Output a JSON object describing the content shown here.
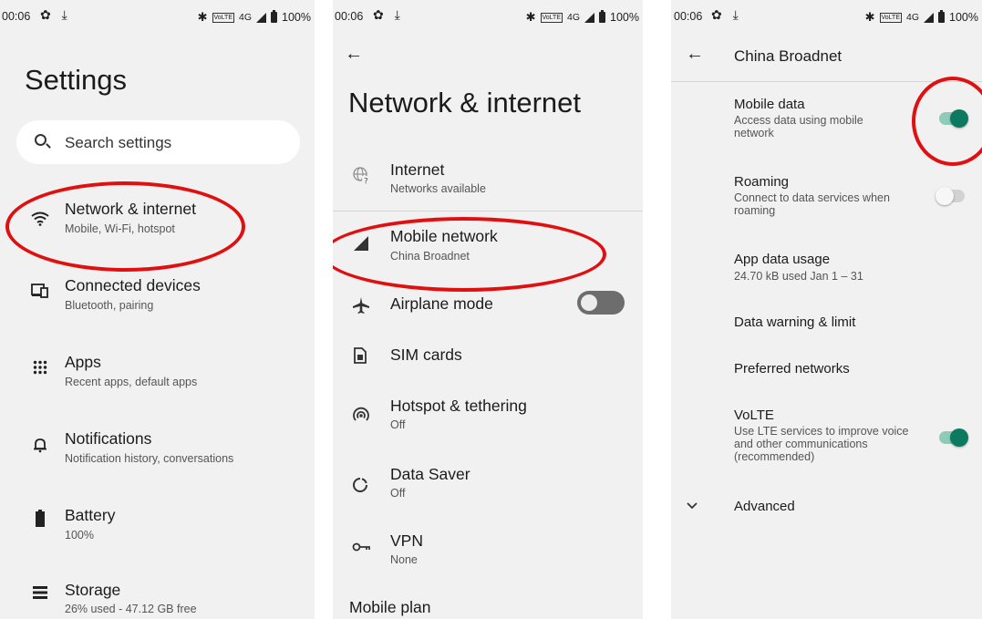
{
  "status_bar": {
    "time": "00:06",
    "left_icons": "✿ ⤓",
    "bluetooth_icon": "bluetooth-icon",
    "volte_badge": "VoLTE",
    "network": "4G",
    "battery": "100%"
  },
  "panel1": {
    "title": "Settings",
    "search_placeholder": "Search settings",
    "items": [
      {
        "title": "Network & internet",
        "subtitle": "Mobile, Wi-Fi, hotspot",
        "icon": "wifi-icon"
      },
      {
        "title": "Connected devices",
        "subtitle": "Bluetooth, pairing",
        "icon": "devices-icon"
      },
      {
        "title": "Apps",
        "subtitle": "Recent apps, default apps",
        "icon": "apps-grid-icon"
      },
      {
        "title": "Notifications",
        "subtitle": "Notification history, conversations",
        "icon": "bell-icon"
      },
      {
        "title": "Battery",
        "subtitle": "100%",
        "icon": "battery-icon"
      },
      {
        "title": "Storage",
        "subtitle": "26% used - 47.12 GB free",
        "icon": "storage-icon"
      }
    ]
  },
  "panel2": {
    "title": "Network & internet",
    "items": [
      {
        "title": "Internet",
        "subtitle": "Networks available",
        "icon": "globe-question-icon"
      },
      {
        "title": "Mobile network",
        "subtitle": "China Broadnet",
        "icon": "signal-icon"
      },
      {
        "title": "Airplane mode",
        "subtitle": "",
        "icon": "airplane-icon",
        "toggle": "off"
      },
      {
        "title": "SIM cards",
        "subtitle": "",
        "icon": "sim-card-icon"
      },
      {
        "title": "Hotspot & tethering",
        "subtitle": "Off",
        "icon": "hotspot-icon"
      },
      {
        "title": "Data Saver",
        "subtitle": "Off",
        "icon": "data-saver-icon"
      },
      {
        "title": "VPN",
        "subtitle": "None",
        "icon": "vpn-key-icon"
      },
      {
        "title": "Mobile plan",
        "subtitle": ""
      }
    ]
  },
  "panel3": {
    "title": "China Broadnet",
    "items": [
      {
        "title": "Mobile data",
        "subtitle": "Access data using mobile network",
        "toggle": "on"
      },
      {
        "title": "Roaming",
        "subtitle": "Connect to data services when roaming",
        "toggle": "off"
      },
      {
        "title": "App data usage",
        "subtitle": "24.70 kB used Jan 1 – 31"
      },
      {
        "title": "Data warning & limit",
        "subtitle": ""
      },
      {
        "title": "Preferred networks",
        "subtitle": ""
      },
      {
        "title": "VoLTE",
        "subtitle": "Use LTE services to improve voice and other communications (recommended)",
        "toggle": "on"
      },
      {
        "title": "Advanced",
        "subtitle": "",
        "icon": "chevron-down-icon"
      }
    ]
  },
  "colors": {
    "highlight_ring": "#e01010",
    "toggle_on": "#0c7a60",
    "panel_bg": "#f1f1f1"
  }
}
